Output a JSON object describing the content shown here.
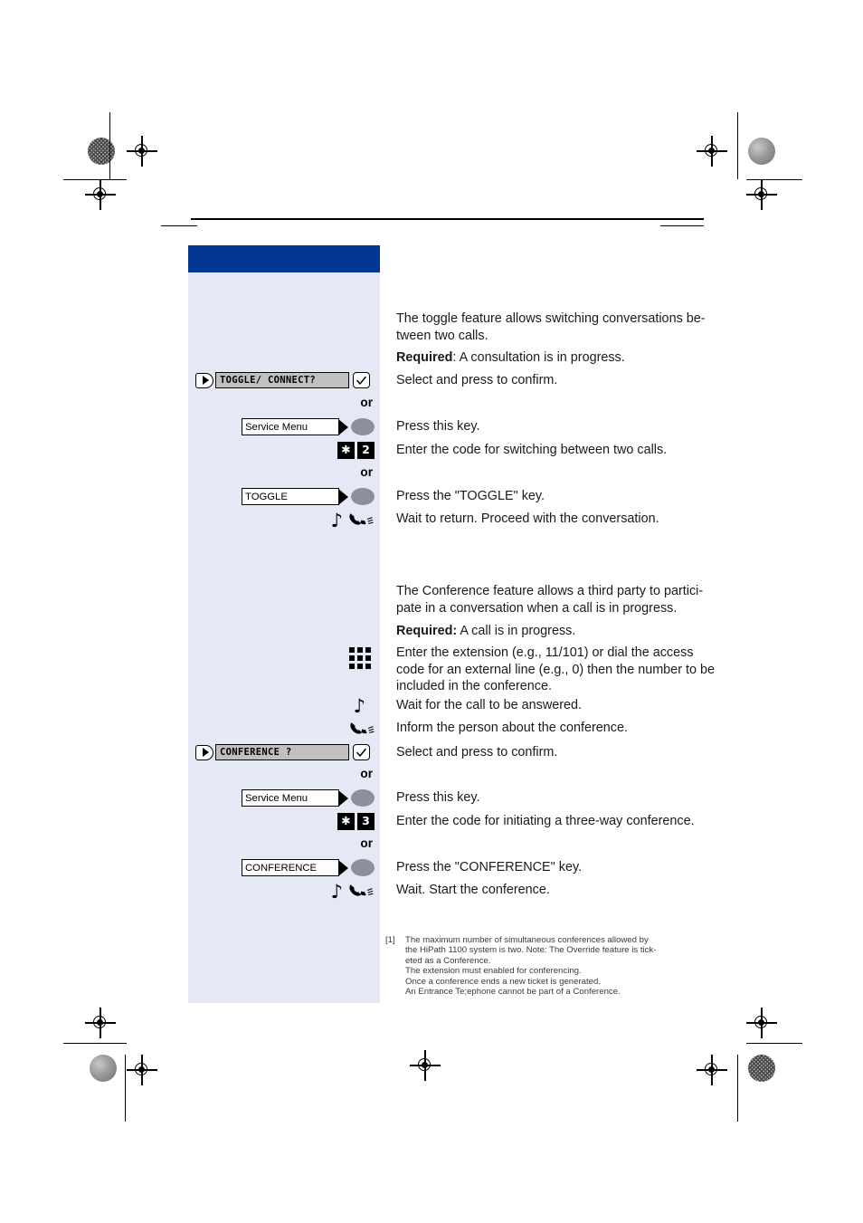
{
  "document": {
    "chapter_title": "",
    "accent_blue": "#023893",
    "panel_blue": "#e4e9f5",
    "display_gray": "#c0c0c0"
  },
  "sections": [
    {
      "id": "toggle",
      "intro": "The toggle feature allows switching conversations be-tween two calls.",
      "required_label": "Required",
      "required_text": ": A consultation is in progress.",
      "steps": [
        {
          "icon": "display-line",
          "display_text": "TOGGLE/ CONNECT?",
          "confirm_icon": "checkmark-icon",
          "text": "Select and press to confirm."
        },
        {
          "icon": "or-separator",
          "text": "or"
        },
        {
          "icon": "function-key",
          "key_label": "Service Menu",
          "text": "Press this key."
        },
        {
          "icon": "code-keys",
          "keys": [
            "✱",
            "2"
          ],
          "text": "Enter the code for switching between two calls."
        },
        {
          "icon": "or-separator",
          "text": "or"
        },
        {
          "icon": "function-key",
          "key_label": "TOGGLE",
          "text": "Press the \"TOGGLE\" key."
        },
        {
          "icon": "tone-and-handset",
          "text": "Wait to return. Proceed with the conversation."
        }
      ]
    },
    {
      "id": "conference",
      "intro": "The Conference feature allows a third party to partici-pate in a conversation when a call is in progress.",
      "required_label": "Required:",
      "required_text": " A call is in progress.",
      "steps": [
        {
          "icon": "dialpad-icon",
          "text": "Enter the extension (e.g., 11/101) or dial the access code for an external line (e.g., 0) then the number to be included in the conference."
        },
        {
          "icon": "tone-icon",
          "text": "Wait for the call to be answered."
        },
        {
          "icon": "handset-icon",
          "text": "Inform the person about the conference."
        },
        {
          "icon": "display-line",
          "display_text": "CONFERENCE ?",
          "confirm_icon": "checkmark-icon",
          "text": "Select and press to confirm."
        },
        {
          "icon": "or-separator",
          "text": "or"
        },
        {
          "icon": "function-key",
          "key_label": "Service Menu",
          "text": "Press this key."
        },
        {
          "icon": "code-keys",
          "keys": [
            "✱",
            "3"
          ],
          "text": "Enter the code for initiating a three-way conference."
        },
        {
          "icon": "or-separator",
          "text": "or"
        },
        {
          "icon": "function-key",
          "key_label": "CONFERENCE",
          "text": "Press the \"CONFERENCE\" key."
        },
        {
          "icon": "tone-and-handset",
          "text": "Wait. Start the conference."
        }
      ]
    }
  ],
  "footnote": {
    "marker": "[1]",
    "lines": [
      "The maximum number of simultaneous conferences allowed by",
      "the HiPath 1100 system is two. Note: The Override feature is tick-",
      "eted as a Conference.",
      "The extension must enabled for conferencing.",
      "Once a conference ends a new ticket is generated.",
      "An Entrance Te;ephone cannot be part of a Conference."
    ]
  },
  "text": {
    "s1_intro_line1": "The toggle feature allows switching conversations be-",
    "s1_intro_line2": "tween two calls.",
    "s1_req_bold": "Required",
    "s1_req_rest": ": A consultation is in progress.",
    "s1_step1": "Select and press to confirm.",
    "s1_display1": "TOGGLE/ CONNECT?",
    "s1_or1": "or",
    "s1_key1": "Service Menu",
    "s1_step2": "Press this key.",
    "s1_code_star": "✱",
    "s1_code_num": "2",
    "s1_step3": "Enter the code for switching between two calls.",
    "s1_or2": "or",
    "s1_key2": "TOGGLE",
    "s1_step4": "Press the \"TOGGLE\" key.",
    "s1_step5": "Wait to return. Proceed with the conversation.",
    "s2_intro_line1": "The Conference feature allows a third party to partici-",
    "s2_intro_line2": "pate in a conversation when a call is in progress.",
    "s2_req_bold": "Required:",
    "s2_req_rest": " A call is in progress.",
    "s2_step1_l1": "Enter the extension (e.g., 11/101) or dial the access",
    "s2_step1_l2": "code for an external line (e.g., 0) then the number to be",
    "s2_step1_l3": "included in the conference.",
    "s2_step2": "Wait for the call to be answered.",
    "s2_step3": "Inform the person about the conference.",
    "s2_display1": "CONFERENCE ?",
    "s2_step4": "Select and press to confirm.",
    "s2_or1": "or",
    "s2_key1": "Service Menu",
    "s2_step5": "Press this key.",
    "s2_code_star": "✱",
    "s2_code_num": "3",
    "s2_step6": "Enter the code for initiating a three-way conference.",
    "s2_or2": "or",
    "s2_key2": "CONFERENCE",
    "s2_step7": "Press the \"CONFERENCE\" key.",
    "s2_step8": "Wait. Start the conference.",
    "fn_marker": "[1]",
    "fn_l1": "The maximum number of simultaneous conferences allowed by",
    "fn_l2": "the HiPath 1100 system is two. Note: The Override feature is tick-",
    "fn_l3": "eted as a Conference.",
    "fn_l4": "The extension must enabled for conferencing.",
    "fn_l5": "Once a conference ends a new ticket is generated.",
    "fn_l6": "An Entrance Te;ephone cannot be part of a Conference."
  }
}
